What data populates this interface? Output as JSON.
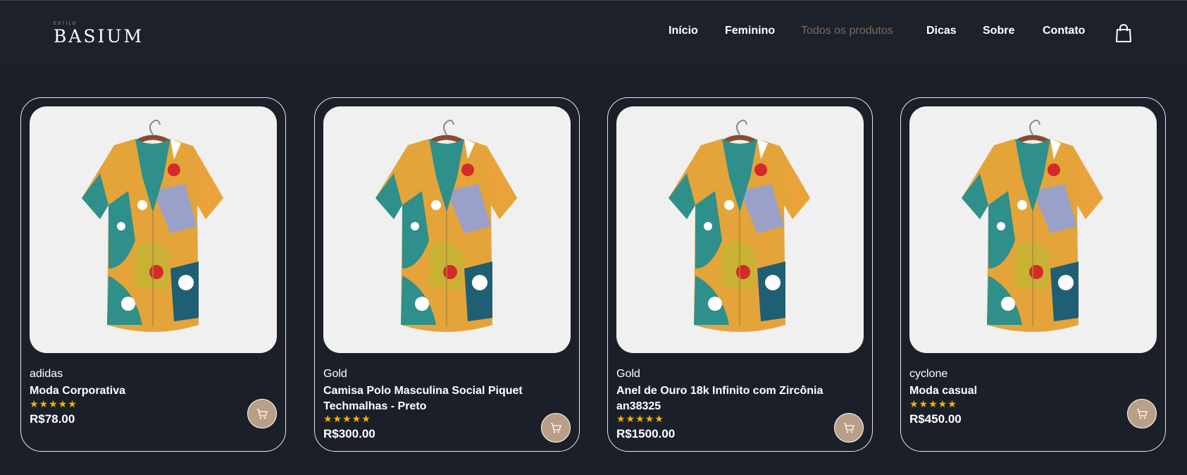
{
  "header": {
    "logo_small": "ESTILO",
    "logo_text": "BASIUM",
    "nav": [
      {
        "label": "Início",
        "active": false
      },
      {
        "label": "Feminino",
        "active": false
      },
      {
        "label": "Todos os produtos",
        "active": true
      },
      {
        "label": "Dicas",
        "active": false
      },
      {
        "label": "Sobre",
        "active": false
      },
      {
        "label": "Contato",
        "active": false
      }
    ],
    "bag_icon": "shopping-bag-icon"
  },
  "products": [
    {
      "brand": "adidas",
      "title": "Moda Corporativa",
      "stars": "★★★★★",
      "rating": 5,
      "price": "R$78.00"
    },
    {
      "brand": "Gold",
      "title": "Camisa Polo Masculina Social Piquet Techmalhas - Preto",
      "stars": "★★★★★",
      "rating": 5,
      "price": "R$300.00"
    },
    {
      "brand": "Gold",
      "title": "Anel de Ouro 18k Infinito com Zircônia an38325",
      "stars": "★★★★★",
      "rating": 5,
      "price": "R$1500.00"
    },
    {
      "brand": "cyclone",
      "title": "Moda casual",
      "stars": "★★★★★",
      "rating": 5,
      "price": "R$450.00"
    }
  ],
  "colors": {
    "background": "#1b2028",
    "active_nav": "#7a6a5e",
    "star": "#f5b400",
    "cart_button": "#b99f88"
  }
}
